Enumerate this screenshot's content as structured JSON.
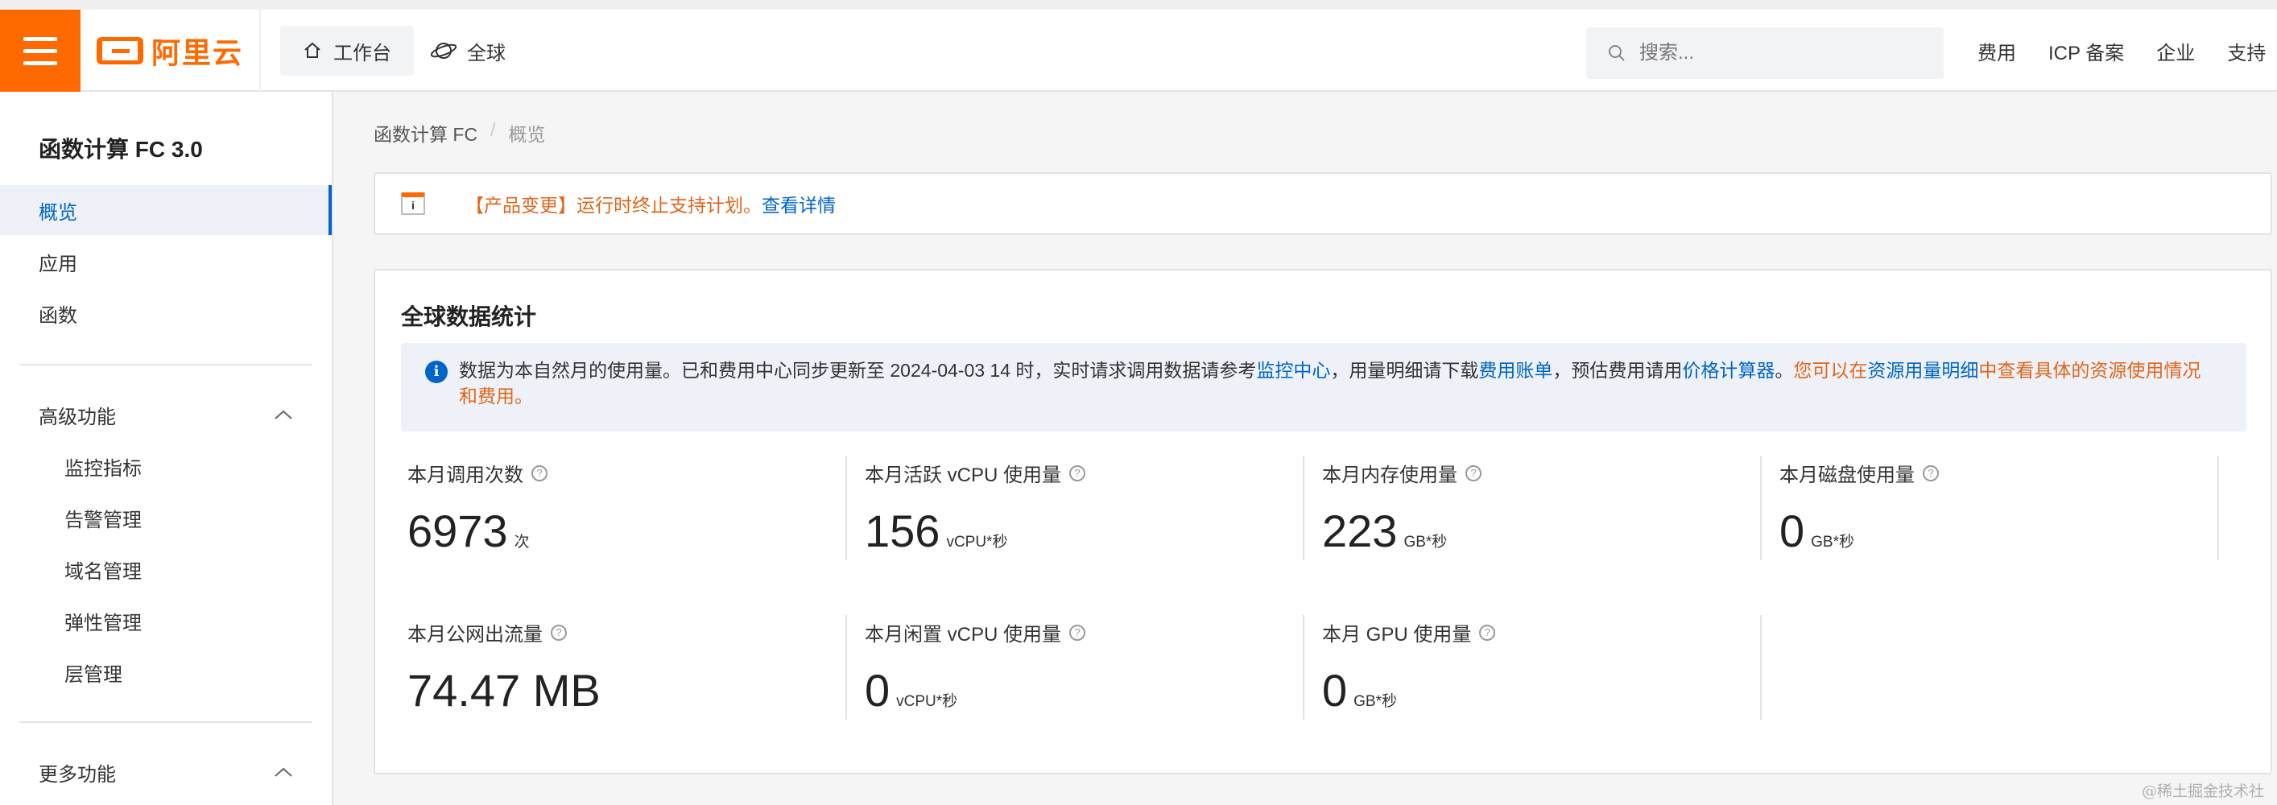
{
  "header": {
    "logo_text": "阿里云",
    "nav_home_label": "工作台",
    "nav_global_label": "全球",
    "search_placeholder": "搜索...",
    "links": [
      "费用",
      "ICP 备案",
      "企业",
      "支持"
    ]
  },
  "sidebar": {
    "title": "函数计算 FC 3.0",
    "items": [
      "概览",
      "应用",
      "函数"
    ],
    "advanced_group": "高级功能",
    "advanced_items": [
      "监控指标",
      "告警管理",
      "域名管理",
      "弹性管理",
      "层管理"
    ],
    "more_group": "更多功能"
  },
  "breadcrumb": {
    "root": "函数计算 FC",
    "sep": "/",
    "current": "概览"
  },
  "notice": {
    "icon_letter": "i",
    "text": "【产品变更】运行时终止支持计划。",
    "link": "查看详情"
  },
  "card": {
    "title": "全球数据统计",
    "info_icon": "i",
    "info": {
      "t1": "数据为本自然月的使用量。已和费用中心同步更新至 2024-04-03 14 时，实时请求调用数据请参考",
      "l1": "监控中心",
      "t2": "，用量明细请下载",
      "l2": "费用账单",
      "t3": "，预估费用请用",
      "l3": "价格计算器",
      "t4": "。",
      "o1": "您可以在",
      "l4": "资源用量明细",
      "o2": "中查看具体的资源使用情况和费用。"
    },
    "stats": [
      {
        "label": "本月调用次数",
        "value": "6973",
        "unit": "次"
      },
      {
        "label": "本月活跃 vCPU 使用量",
        "value": "156",
        "unit": "vCPU*秒"
      },
      {
        "label": "本月内存使用量",
        "value": "223",
        "unit": "GB*秒"
      },
      {
        "label": "本月磁盘使用量",
        "value": "0",
        "unit": "GB*秒"
      },
      {
        "label": "本月公网出流量",
        "value": "74.47 MB",
        "unit": ""
      },
      {
        "label": "本月闲置 vCPU 使用量",
        "value": "0",
        "unit": "vCPU*秒"
      },
      {
        "label": "本月 GPU 使用量",
        "value": "0",
        "unit": "GB*秒"
      }
    ],
    "help_glyph": "?"
  },
  "watermark": "@稀土掘金技术社区",
  "colors": {
    "brand": "#ff6a00",
    "link": "#0064c8",
    "warning_text": "#e0661a"
  }
}
